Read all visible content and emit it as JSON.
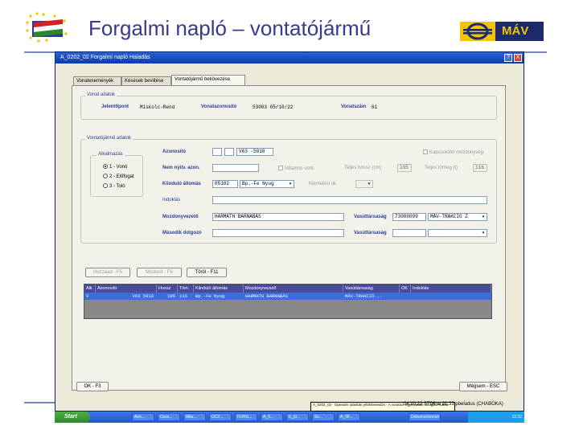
{
  "slide": {
    "title": "Forgalmi napló – vontatójármű",
    "logo_text": "MÁV"
  },
  "window": {
    "title": "A_0202_02 Forgalmi napló Haladás",
    "help": "?",
    "close": "X"
  },
  "tabs": [
    {
      "label": "Vonateseményék"
    },
    {
      "label": "Késések beviitése"
    },
    {
      "label": "Vontatójármű bekövezése"
    }
  ],
  "train_data": {
    "group_title": "Vonat adatok",
    "origin_label": "Jelentőpont",
    "origin_value": "Miskolc-Rend",
    "train_id_label": "Vonatazonosító",
    "train_id_value": "53003 05/10/22",
    "train_no_label": "Vonatszám",
    "train_no_value": "61"
  },
  "vehicle_data": {
    "group_title": "Vontatójármű adatok",
    "position_group": "Alkalmazás",
    "options": [
      {
        "label": "1 - Vonó",
        "selected": true
      },
      {
        "label": "2 - Előfogat",
        "selected": false
      },
      {
        "label": "3 - Toló",
        "selected": false
      }
    ],
    "id_label": "Azonosító",
    "id_value": "V63 -5018",
    "nonreg_label": "Nem nyilv. azon.",
    "electric_label": "Villamos vont.",
    "length_label": "Teljes hossz (cm)",
    "length_value": "195",
    "weight_label": "Teljes tömeg (t)",
    "weight_value": "116",
    "coupling_label": "Kapcsolódó mozdonyvég",
    "station_label": "Kiinduló állomás",
    "station_code": "05102",
    "station_name": "Bp.-Fe Nyug",
    "reason_label": "Kiemelési ok",
    "note_label": "Indoklás",
    "driver_label": "Mozdonyvezető",
    "driver_value": "HARMATH BARNABÁS",
    "company_label": "Vasúttársaság",
    "company_code": "73000099",
    "company_name": "MÁV-TRAKCIÓ Z",
    "second_label": "Második dolgozó",
    "company2_label": "Vasúttársaság"
  },
  "buttons": {
    "add": "Hozzáad - F5",
    "modify": "Módosít - F6",
    "delete": "Töröl - F11",
    "ok": "OK - F3",
    "cancel": "Mégsem - ESC"
  },
  "grid": {
    "columns": [
      "Alk",
      "Azonosító",
      "Hossz",
      "Töm",
      "Kiinduló állomás",
      "Mozdonyvezető",
      "Vasúttársaság",
      "OK",
      "Indoklás"
    ],
    "rows": [
      [
        "V",
        "V63 5018",
        "195",
        "116",
        "Bp.-Fe Nyug",
        "HARMATH BARNABÁS",
        "MÁV-TRAKCIÓ...",
        "",
        ""
      ]
    ]
  },
  "taskbar": {
    "start": "Start",
    "items": [
      "Ann...",
      "Ossz...",
      "Mitu...",
      "OC2...",
      "FORU...",
      "A_0...",
      "5_(0...",
      "Sz...",
      "A_0F..."
    ],
    "tray": "12:32",
    "doc_item": "Dokumentumok"
  },
  "tooltip": "A_0202_02 - Operatív utasítás jelöltmenedzs - A vonatos egyhivatást szolgáló Kafka",
  "stamp": "04.10.22 ST06 at 21.33 pbeladus (CHABOKA)"
}
